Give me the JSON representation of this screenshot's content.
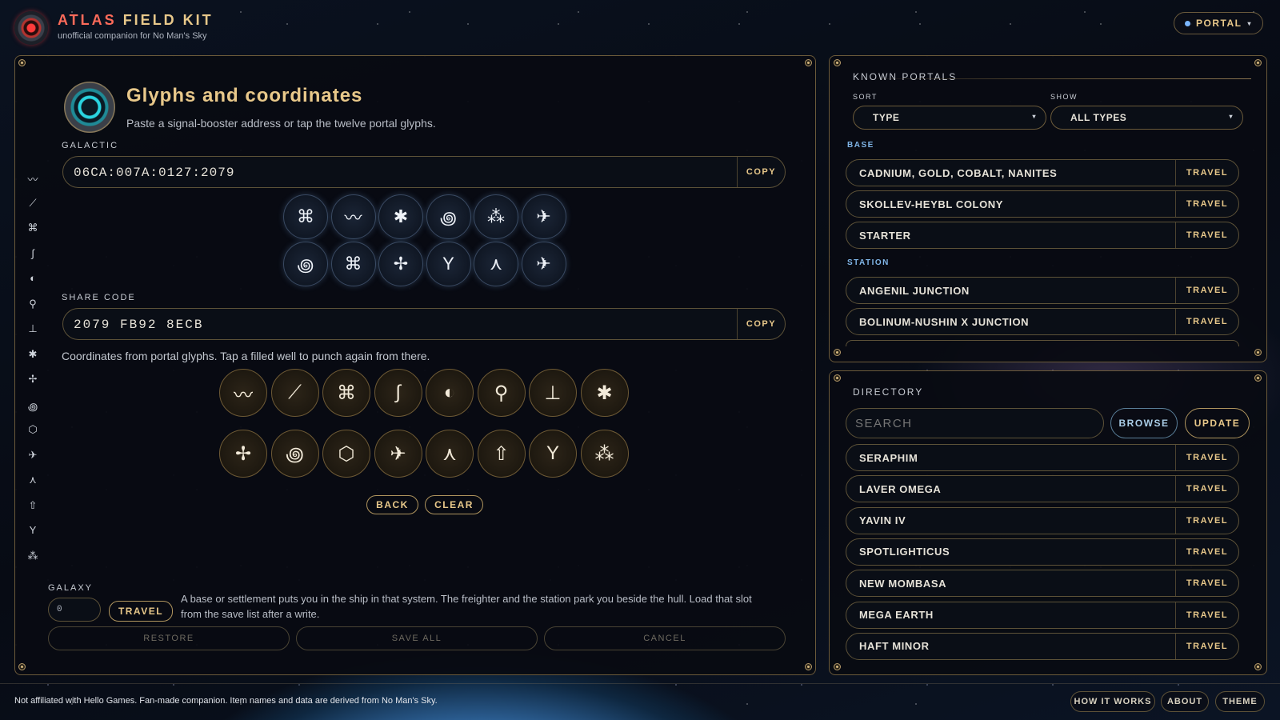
{
  "header": {
    "brand_a": "ATLAS",
    "brand_b": "FIELD KIT",
    "tagline": "unofficial companion for No Man's Sky",
    "portal_label": "PORTAL",
    "portal_caret": "▾"
  },
  "main": {
    "title": "Glyphs and coordinates",
    "subtitle": "Paste a signal-booster address or tap the twelve portal glyphs.",
    "galactic_label": "GALACTIC",
    "galactic_value": "06CA:007A:0127:2079",
    "copy_label": "COPY",
    "share_label": "SHARE CODE",
    "share_value": "2079 FB92 8ECB",
    "hint": "Coordinates from portal glyphs. Tap a filled well to punch again from there.",
    "preview_glyphs": [
      "sunset-icon",
      "eclipse-icon",
      "bug-icon",
      "spiral-icon",
      "triangles-icon",
      "ship-icon",
      "spiral-icon",
      "sunset-icon",
      "dragonfly-icon",
      "tree-icon",
      "tent-icon",
      "ship-icon"
    ],
    "preview_chars": [
      "⌘",
      "〰",
      "✱",
      "꩜",
      "⁂",
      "✈",
      "꩜",
      "⌘",
      "✢",
      "Y",
      "⋏",
      "✈"
    ],
    "keypad_glyphs": [
      "eclipse-icon",
      "bird-icon",
      "sunset-icon",
      "diplo-icon",
      "eclipse-moon-icon",
      "balloon-icon",
      "boat-icon",
      "bug-icon",
      "dragonfly-icon",
      "spiral-icon",
      "hexagon-icon",
      "ship-icon",
      "tent-icon",
      "rocket-icon",
      "tree-icon",
      "triangles-icon"
    ],
    "keypad_chars": [
      "〰",
      "⟋",
      "⌘",
      "∫",
      "◐",
      "⚲",
      "⊥",
      "✱",
      "✢",
      "꩜",
      "⬡",
      "✈",
      "⋏",
      "⇧",
      "Y",
      "⁂"
    ],
    "back_label": "BACK",
    "clear_label": "CLEAR",
    "galaxy_label": "GALAXY",
    "galaxy_value": "0",
    "travel_label": "TRAVEL",
    "note": "A base or settlement puts you in the ship in that system. The freighter and the station park you beside the hull. Load that slot from the save list after a write.",
    "restore_label": "RESTORE",
    "save_all_label": "SAVE ALL",
    "cancel_label": "CANCEL"
  },
  "sidebar": {
    "chars": [
      "〰",
      "⟋",
      "⌘",
      "∫",
      "◐",
      "⚲",
      "⊥",
      "✱",
      "✢",
      "꩜",
      "⬡",
      "✈",
      "⋏",
      "⇧",
      "Y",
      "⁂"
    ]
  },
  "portals": {
    "title": "KNOWN PORTALS",
    "sort_label": "SORT",
    "sort_value": "TYPE",
    "show_label": "SHOW",
    "show_value": "ALL TYPES",
    "caret": "▾",
    "base_label": "BASE",
    "base_items": [
      "CADNIUM, GOLD, COBALT, NANITES",
      "SKOLLEV-HEYBL COLONY",
      "STARTER"
    ],
    "station_label": "STATION",
    "station_items": [
      "ANGENIL JUNCTION",
      "BOLINUM-NUSHIN X JUNCTION"
    ],
    "travel_label": "TRAVEL"
  },
  "directory": {
    "title": "DIRECTORY",
    "search_placeholder": "SEARCH",
    "browse_label": "BROWSE",
    "update_label": "UPDATE",
    "items": [
      "SERAPHIM",
      "LAVER OMEGA",
      "YAVIN IV",
      "SPOTLIGHTICUS",
      "NEW MOMBASA",
      "MEGA EARTH",
      "HAFT MINOR"
    ],
    "travel_label": "TRAVEL"
  },
  "footer": {
    "disclaimer": "Not affiliated with Hello Games. Fan-made companion. Item names and data are derived from No Man's Sky.",
    "how_label": "HOW IT WORKS",
    "about_label": "ABOUT",
    "theme_label": "THEME"
  }
}
